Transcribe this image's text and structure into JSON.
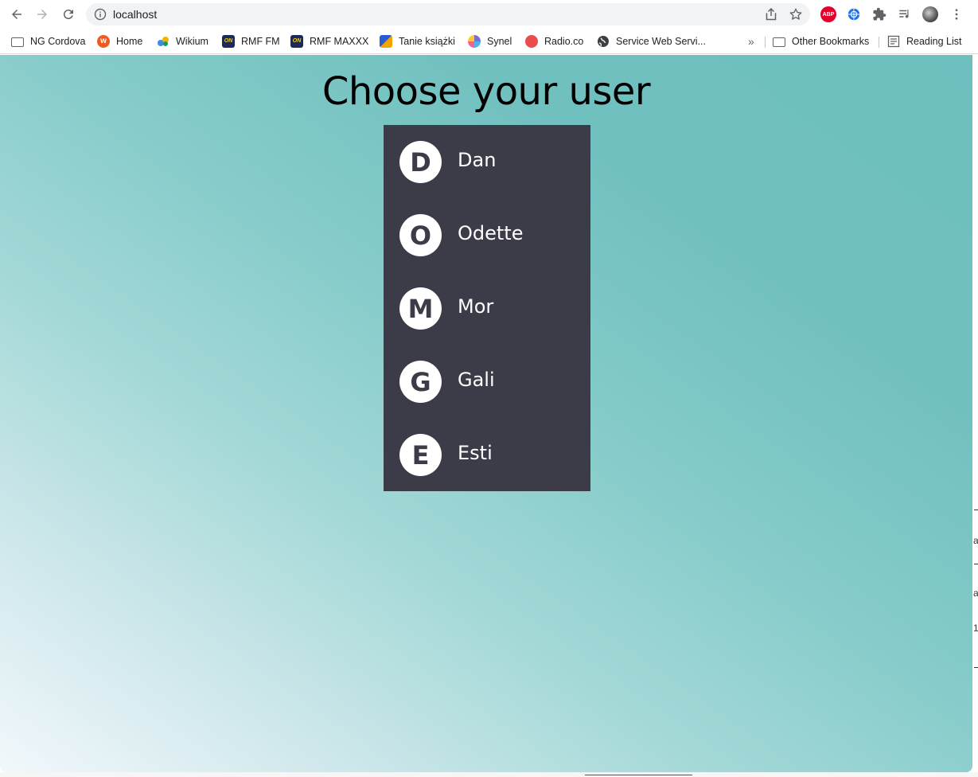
{
  "browser": {
    "url": "localhost",
    "extensions": [
      "adblock-icon",
      "globe-extension-icon",
      "puzzle-icon",
      "reading-queue-icon",
      "profile-avatar"
    ],
    "abp_label": "ABP"
  },
  "bookmarks": {
    "items": [
      {
        "label": "NG Cordova",
        "icon": "folder-icon"
      },
      {
        "label": "Home",
        "icon": "wikium-home-icon",
        "color": "#f05a22"
      },
      {
        "label": "Wikium",
        "icon": "wikium-icon",
        "color": "#3a8de0"
      },
      {
        "label": "RMF FM",
        "icon": "rmf-on-icon",
        "color": "#1b2a5a"
      },
      {
        "label": "RMF MAXXX",
        "icon": "rmf-on-icon",
        "color": "#1b2a5a"
      },
      {
        "label": "Tanie książki",
        "icon": "books-icon",
        "color": "#2a5bd7"
      },
      {
        "label": "Synel",
        "icon": "synel-icon",
        "color": "#7a6fd0"
      },
      {
        "label": "Radio.co",
        "icon": "radio-co-icon",
        "color": "#e84c4c"
      },
      {
        "label": "Service Web Servi...",
        "icon": "globe-icon",
        "color": "#202124"
      }
    ],
    "overflow_label": "»",
    "other_bookmarks": "Other Bookmarks",
    "reading_list": "Reading List"
  },
  "page": {
    "title": "Choose your user",
    "users": [
      {
        "initial": "D",
        "name": "Dan"
      },
      {
        "initial": "O",
        "name": "Odette"
      },
      {
        "initial": "M",
        "name": "Mor"
      },
      {
        "initial": "G",
        "name": "Gali"
      },
      {
        "initial": "E",
        "name": "Esti"
      }
    ],
    "colors": {
      "panel": "#3b3c48",
      "background_top_right": "#6dc0bf",
      "background_bottom_left": "#f2f8fc"
    }
  },
  "behind_window": {
    "fragments": [
      "a",
      "a",
      "1"
    ]
  }
}
